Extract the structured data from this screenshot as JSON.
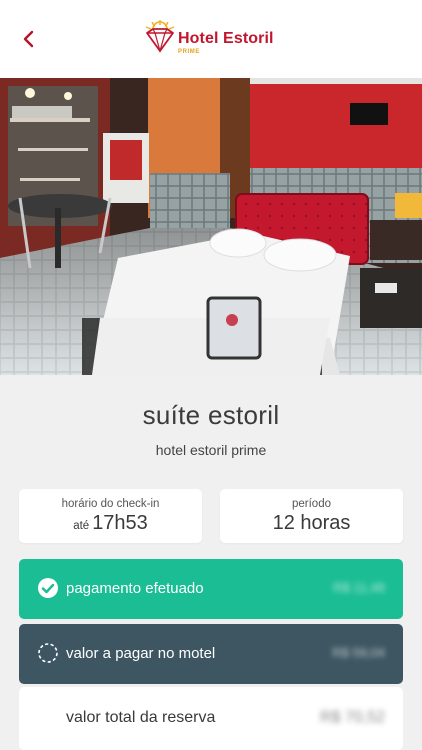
{
  "header": {
    "back_icon": "chevron-left-icon",
    "logo_name": "Hotel Estoril",
    "logo_sub": "PRIME",
    "brand_color": "#c0172e",
    "accent_color": "#e8a21a"
  },
  "hero": {
    "image": "suite-bedroom-photo"
  },
  "suite": {
    "title": "suíte estoril",
    "hotel": "hotel estoril prime"
  },
  "checkin": {
    "label": "horário do check-in",
    "prefix": "até",
    "time": "17h53"
  },
  "period": {
    "label": "período",
    "value": "12 horas"
  },
  "payment": {
    "paid_label": "pagamento efetuado",
    "paid_amount": "R$ 11,48",
    "paid_color": "#1bbd94",
    "due_label": "valor a pagar no motel",
    "due_amount": "R$ 59,04",
    "due_color": "#3d5661",
    "total_label": "valor total da reserva",
    "total_amount": "R$ 70,52"
  }
}
